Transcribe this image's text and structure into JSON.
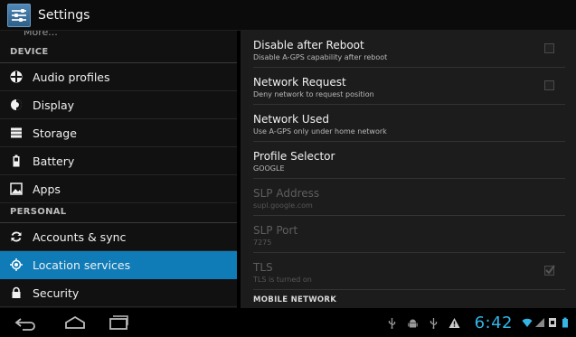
{
  "app": {
    "title": "Settings"
  },
  "left": {
    "more_label": "More...",
    "device_header": "DEVICE",
    "personal_header": "PERSONAL",
    "device_items": [
      {
        "label": "Audio profiles",
        "icon": "audio-profiles-icon"
      },
      {
        "label": "Display",
        "icon": "display-icon"
      },
      {
        "label": "Storage",
        "icon": "storage-icon"
      },
      {
        "label": "Battery",
        "icon": "battery-icon"
      },
      {
        "label": "Apps",
        "icon": "apps-icon"
      }
    ],
    "personal_items": [
      {
        "label": "Accounts & sync",
        "icon": "sync-icon"
      },
      {
        "label": "Location services",
        "icon": "location-icon",
        "selected": true
      },
      {
        "label": "Security",
        "icon": "lock-icon"
      }
    ]
  },
  "right": {
    "prefs": [
      {
        "title": "Disable after Reboot",
        "summary": "Disable A-GPS capability after reboot",
        "checkbox": true,
        "checked": false,
        "enabled": true
      },
      {
        "title": "Network Request",
        "summary": "Deny network to request position",
        "checkbox": true,
        "checked": false,
        "enabled": true
      },
      {
        "title": "Network Used",
        "summary": "Use A-GPS only under home network",
        "checkbox": false,
        "enabled": true
      },
      {
        "title": "Profile Selector",
        "summary": "GOOGLE",
        "checkbox": false,
        "enabled": true
      },
      {
        "title": "SLP Address",
        "summary": "supl.google.com",
        "checkbox": false,
        "enabled": false
      },
      {
        "title": "SLP Port",
        "summary": "7275",
        "checkbox": false,
        "enabled": false
      },
      {
        "title": "TLS",
        "summary": "TLS is turned on",
        "checkbox": true,
        "checked": true,
        "enabled": false
      }
    ],
    "category_label": "MOBILE NETWORK"
  },
  "statusbar": {
    "time": "6:42",
    "accent_color": "#33b5e5",
    "notification_icons": [
      "usb-icon",
      "android-debug-icon",
      "usb-icon",
      "warning-icon"
    ],
    "system_icons": [
      "wifi-icon",
      "signal-icon",
      "sim-icon",
      "battery-status-icon"
    ]
  },
  "colors": {
    "selected_bg": "#0f7cb8",
    "left_bg": "#111111",
    "right_bg": "#1c1c1c"
  }
}
